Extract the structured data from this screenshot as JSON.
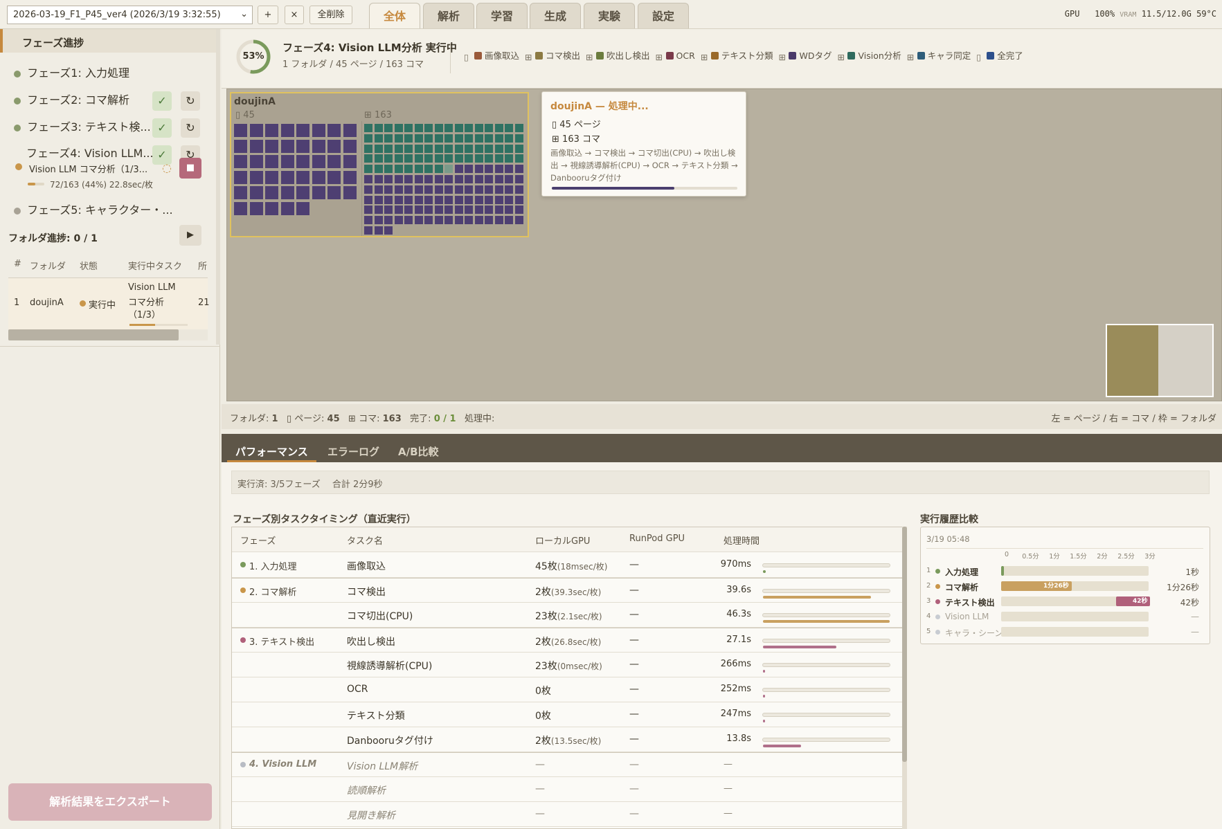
{
  "topbar": {
    "run_select": "2026-03-19_F1_P45_ver4 (2026/3/19 3:32:55)",
    "add_label": "+",
    "close_label": "×",
    "clear_all_label": "全削除",
    "tabs": [
      "全体",
      "解析",
      "学習",
      "生成",
      "実験",
      "設定"
    ],
    "active_tab": "全体",
    "gpu_label": "GPU",
    "gpu_value": "100%",
    "vram_label": "VRAM",
    "vram_value": "11.5/12.0G",
    "temp": "59°C"
  },
  "sidebar": {
    "title": "フェーズ進捗",
    "phases": [
      {
        "label": "フェーズ1: 入力処理",
        "status": "done",
        "dot": "#8a9a6c"
      },
      {
        "label": "フェーズ2: コマ解析",
        "status": "done",
        "dot": "#8a9a6c"
      },
      {
        "label": "フェーズ3: テキスト検...",
        "status": "done",
        "dot": "#8a9a6c"
      },
      {
        "label": "フェーズ4: Vision LLM...",
        "status": "running",
        "dot": "#c9964a",
        "sub": "Vision LLM コマ分析（1/3...",
        "progress_text": "72/163 (44%) 22.8sec/枚",
        "progress": 0.44
      },
      {
        "label": "フェーズ5: キャラクター・...",
        "status": "pending",
        "dot": "#a8a295"
      }
    ],
    "done_mark": "✓",
    "refresh_mark": "↻",
    "stop_mark": "■",
    "play_mark": "▶",
    "folder_progress": "フォルダ進捗: 0 / 1",
    "table": {
      "headers": [
        "#",
        "フォルダ",
        "状態",
        "実行中タスク",
        "所"
      ],
      "rows": [
        {
          "num": "1",
          "folder": "doujinA",
          "state": "実行中",
          "task1": "Vision LLM",
          "task2": "コマ分析",
          "task3": "（1/3）",
          "extra": "21"
        }
      ]
    },
    "export_label": "解析結果をエクスポート"
  },
  "summary": {
    "percent_text": "53%",
    "percent": 0.53,
    "title": "フェーズ4: Vision LLM分析 実行中",
    "subtitle": "1 フォルダ / 45 ページ / 163 コマ",
    "legend": [
      {
        "label": "画像取込",
        "color": "#9a5a3a",
        "icon": "page-icon"
      },
      {
        "label": "コマ検出",
        "color": "#8c7a42",
        "icon": "grid-icon"
      },
      {
        "label": "吹出し検出",
        "color": "#6b7c3e",
        "icon": "grid-icon"
      },
      {
        "label": "OCR",
        "color": "#7a3a4a",
        "icon": "grid-icon"
      },
      {
        "label": "テキスト分類",
        "color": "#9a6a2a",
        "icon": "grid-icon"
      },
      {
        "label": "WDタグ",
        "color": "#4a3a6a",
        "icon": "grid-icon"
      },
      {
        "label": "Vision分析",
        "color": "#2f6b5e",
        "icon": "grid-icon"
      },
      {
        "label": "キャラ同定",
        "color": "#2e5d7a",
        "icon": "grid-icon"
      },
      {
        "label": "全完了",
        "color": "#2c4f8c",
        "icon": "page-icon"
      }
    ]
  },
  "canvas": {
    "folder_name": "doujinA",
    "pages_count": "45",
    "koma_count": "163",
    "koma_done": 72,
    "tooltip": {
      "title": "doujinA — 処理中...",
      "pages": "45 ページ",
      "koma": "163 コマ",
      "pipeline": "画像取込 → コマ検出 → コマ切出(CPU) → 吹出し検出 → 視線誘導解析(CPU) → OCR → テキスト分類 → Danbooruタグ付け",
      "progress": 0.66
    }
  },
  "statusbar": {
    "folder_label": "フォルダ:",
    "folder_value": "1",
    "page_label": "ページ:",
    "page_value": "45",
    "koma_label": "コマ:",
    "koma_value": "163",
    "done_label": "完了:",
    "done_value": "0 / 1",
    "processing_label": "処理中:",
    "hint": "左 = ページ / 右 = コマ / 枠 = フォルダ"
  },
  "perf": {
    "tabs": [
      "パフォーマンス",
      "エラーログ",
      "A/B比較"
    ],
    "exec_summary": "実行済: 3/5フェーズ　 合計 2分9秒",
    "timing_title": "フェーズ別タスクタイミング（直近実行）",
    "headers": [
      "フェーズ",
      "タスク名",
      "ローカルGPU",
      "RunPod GPU",
      "処理時間"
    ],
    "rows": [
      {
        "phase": "1. 入力処理",
        "dot": "#7a9a5c",
        "task": "画像取込",
        "local": "45枚",
        "rate": "(18msec/枚)",
        "runpod": "—",
        "time": "970ms",
        "frac": 0.02,
        "color": "#7a9a5c"
      },
      {
        "phase": "2. コマ解析",
        "dot": "#c9964a",
        "task": "コマ検出",
        "local": "2枚",
        "rate": "(39.3sec/枚)",
        "runpod": "—",
        "time": "39.6s",
        "frac": 0.85,
        "color": "#c9a060"
      },
      {
        "phase": "",
        "dot": "",
        "task": "コマ切出(CPU)",
        "local": "23枚",
        "rate": "(2.1sec/枚)",
        "runpod": "—",
        "time": "46.3s",
        "frac": 1.0,
        "color": "#c9a060"
      },
      {
        "phase": "3. テキスト検出",
        "dot": "#b0607a",
        "task": "吹出し検出",
        "local": "2枚",
        "rate": "(26.8sec/枚)",
        "runpod": "—",
        "time": "27.1s",
        "frac": 0.58,
        "color": "#b0708a"
      },
      {
        "phase": "",
        "dot": "",
        "task": "視線誘導解析(CPU)",
        "local": "23枚",
        "rate": "(0msec/枚)",
        "runpod": "—",
        "time": "266ms",
        "frac": 0.01,
        "color": "#b0708a"
      },
      {
        "phase": "",
        "dot": "",
        "task": "OCR",
        "local": "0枚",
        "rate": "",
        "runpod": "—",
        "time": "252ms",
        "frac": 0.01,
        "color": "#b0708a"
      },
      {
        "phase": "",
        "dot": "",
        "task": "テキスト分類",
        "local": "0枚",
        "rate": "",
        "runpod": "—",
        "time": "247ms",
        "frac": 0.01,
        "color": "#b0708a"
      },
      {
        "phase": "",
        "dot": "",
        "task": "Danbooruタグ付け",
        "local": "2枚",
        "rate": "(13.5sec/枚)",
        "runpod": "—",
        "time": "13.8s",
        "frac": 0.3,
        "color": "#b0708a"
      },
      {
        "phase": "4. Vision LLM",
        "dot": "#b8bcc4",
        "task": "Vision LLM解析",
        "local": "—",
        "rate": "",
        "runpod": "—",
        "time": "—",
        "frac": 0,
        "color": "",
        "muted": true
      },
      {
        "phase": "",
        "dot": "",
        "task": "読順解析",
        "local": "—",
        "rate": "",
        "runpod": "—",
        "time": "—",
        "frac": 0,
        "color": "",
        "muted": true
      },
      {
        "phase": "",
        "dot": "",
        "task": "見開き解析",
        "local": "—",
        "rate": "",
        "runpod": "—",
        "time": "—",
        "frac": 0,
        "color": "",
        "muted": true
      }
    ],
    "history_title": "実行履歴比較",
    "history": {
      "date": "3/19 05:48",
      "ticks": [
        "0",
        "0.5分",
        "1分",
        "1.5分",
        "2分",
        "2.5分",
        "3分"
      ],
      "max_seconds": 180,
      "rows": [
        {
          "n": "1",
          "label": "入力処理",
          "dot": "#7a9a5c",
          "seconds": 1,
          "bar_label": "",
          "time": "1秒",
          "color": "#7a9a5c",
          "muted": false
        },
        {
          "n": "2",
          "label": "コマ解析",
          "dot": "#c9964a",
          "seconds": 86,
          "bar_label": "1分26秒",
          "time": "1分26秒",
          "color": "#c9a060",
          "muted": false
        },
        {
          "n": "3",
          "label": "テキスト検出",
          "dot": "#b0607a",
          "seconds": 42,
          "bar_label": "42秒",
          "time": "42秒",
          "color": "#b0607a",
          "muted": false
        },
        {
          "n": "4",
          "label": "Vision LLM",
          "dot": "#c8ccd2",
          "seconds": 0,
          "bar_label": "",
          "time": "—",
          "color": "",
          "muted": true
        },
        {
          "n": "5",
          "label": "キャラ・シーン",
          "dot": "#c8ccd2",
          "seconds": 0,
          "bar_label": "",
          "time": "—",
          "color": "",
          "muted": true
        }
      ]
    }
  }
}
